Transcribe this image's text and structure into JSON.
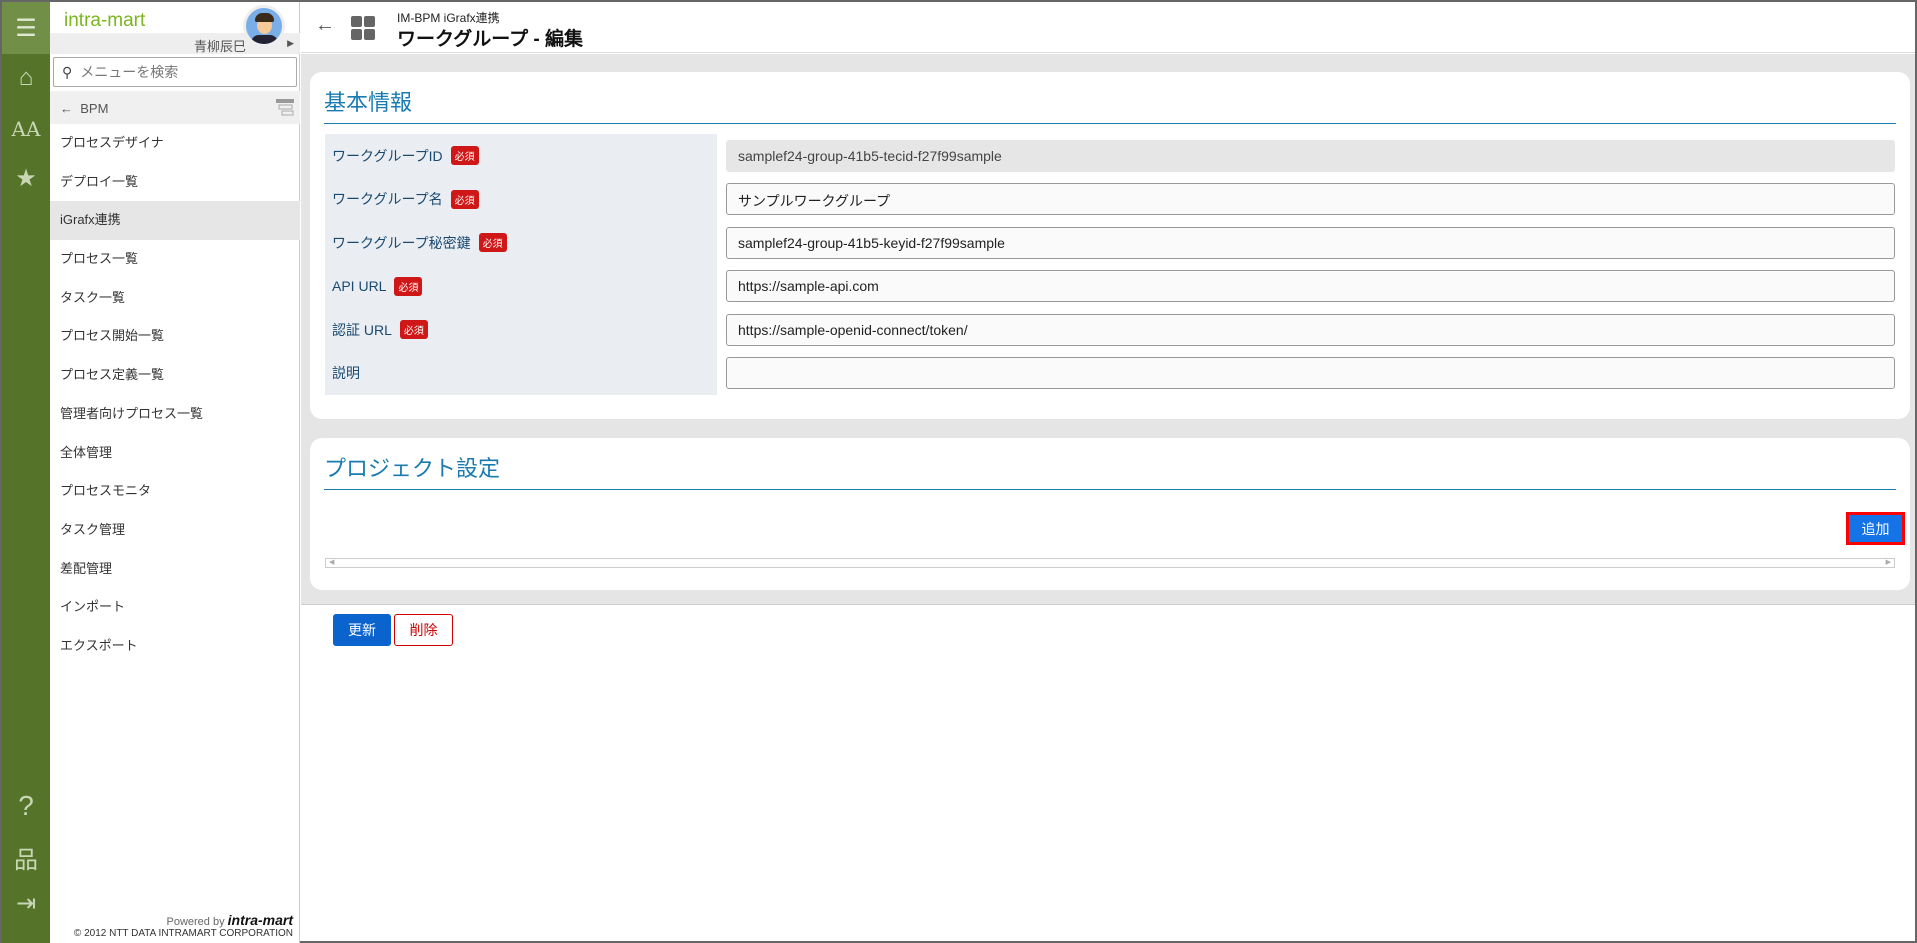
{
  "rail": {
    "icons": [
      "menu-icon",
      "home-icon",
      "font-size-icon",
      "star-icon",
      "help-icon",
      "sitemap-icon",
      "logout-icon"
    ]
  },
  "sidebar": {
    "logo": "intra-mart",
    "user_name": "青柳辰巳",
    "search_placeholder": "メニューを検索",
    "back_label": "BPM",
    "items": [
      {
        "label": "プロセスデザイナ"
      },
      {
        "label": "デプロイ一覧"
      },
      {
        "label": "iGrafx連携",
        "selected": true
      },
      {
        "label": "プロセス一覧"
      },
      {
        "label": "タスク一覧"
      },
      {
        "label": "プロセス開始一覧"
      },
      {
        "label": "プロセス定義一覧"
      },
      {
        "label": "管理者向けプロセス一覧"
      },
      {
        "label": "全体管理"
      },
      {
        "label": "プロセスモニタ"
      },
      {
        "label": "タスク管理"
      },
      {
        "label": "差配管理"
      },
      {
        "label": "インポート"
      },
      {
        "label": "エクスポート"
      }
    ],
    "powered_by": "Powered by",
    "powered_logo": "intra-mart",
    "copyright": "© 2012 NTT DATA INTRAMART CORPORATION"
  },
  "header": {
    "subtitle": "IM-BPM iGrafx連携",
    "title": "ワークグループ - 編集"
  },
  "basic": {
    "title": "基本情報",
    "required_label": "必須",
    "fields": [
      {
        "label": "ワークグループID",
        "required": true,
        "value": "samplef24-group-41b5-tecid-f27f99sample",
        "readonly": true
      },
      {
        "label": "ワークグループ名",
        "required": true,
        "value": "サンプルワークグループ"
      },
      {
        "label": "ワークグループ秘密鍵",
        "required": true,
        "value": "samplef24-group-41b5-keyid-f27f99sample"
      },
      {
        "label": "API URL",
        "required": true,
        "value": "https://sample-api.com"
      },
      {
        "label": "認証 URL",
        "required": true,
        "value": "https://sample-openid-connect/token/"
      },
      {
        "label": "説明",
        "required": false,
        "value": ""
      }
    ]
  },
  "project": {
    "title": "プロジェクト設定",
    "add_label": "追加"
  },
  "actions": {
    "update_label": "更新",
    "delete_label": "削除"
  }
}
